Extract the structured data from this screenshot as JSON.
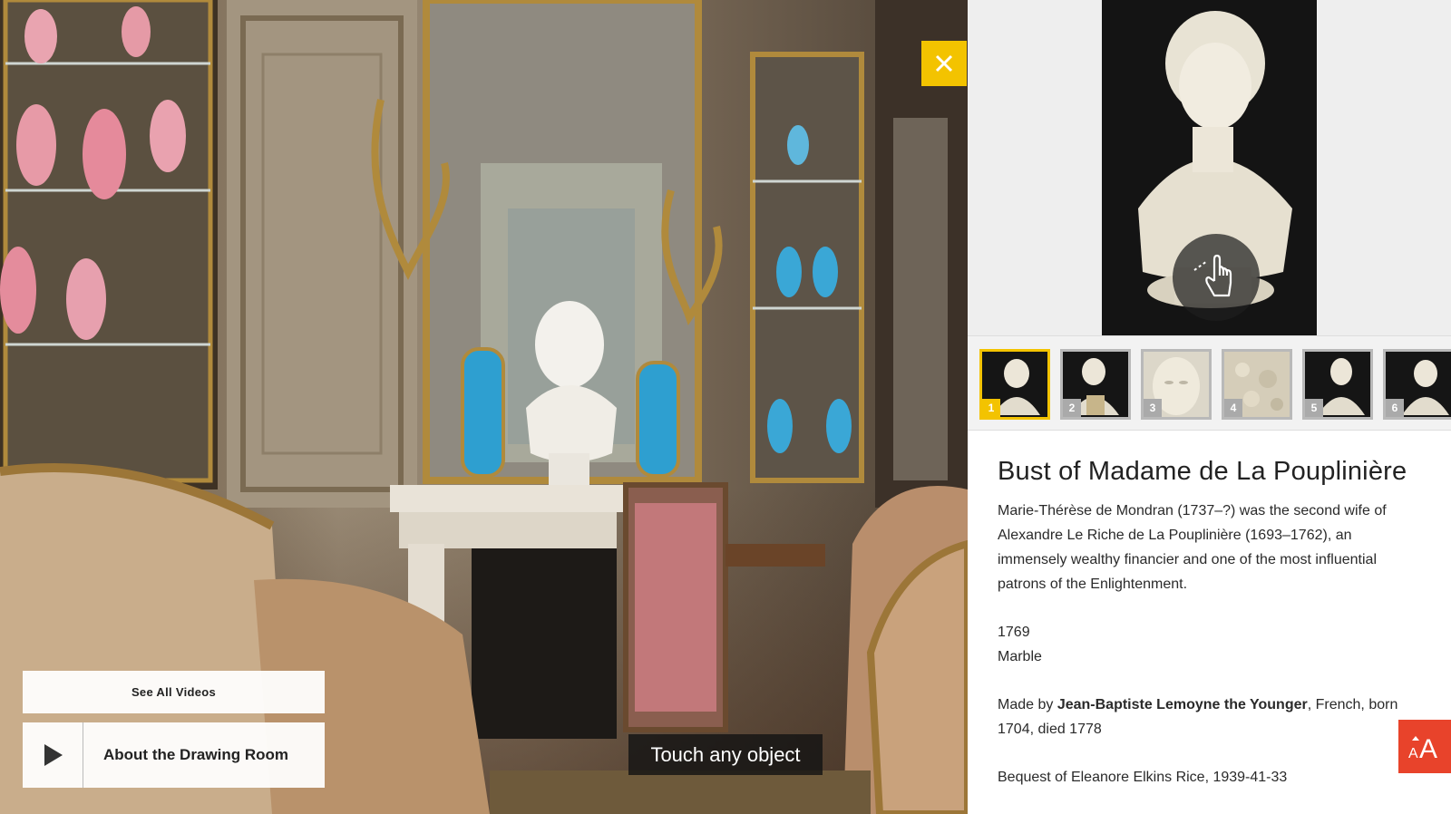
{
  "overlay": {
    "close_icon": "close-icon",
    "see_all_videos": "See All Videos",
    "video_title": "About the Drawing Room",
    "touch_hint": "Touch any object",
    "accent_color": "#f3c300"
  },
  "detail": {
    "title": "Bust of Madame de La Pouplinière",
    "description": "Marie-Thérèse de Mondran (1737–?) was the second wife of Alexandre Le Riche de La Pouplinière (1693–1762), an immensely wealthy financier and one of the most influential patrons of the Enlightenment.",
    "date": "1769",
    "medium": "Marble",
    "made_by_prefix": "Made by ",
    "artist": "Jean-Baptiste Lemoyne the Younger",
    "artist_suffix": ", French, born 1704, died 1778",
    "credit": "Bequest of Eleanore Elkins Rice, 1939-41-33",
    "gesture_icon": "swipe-hand-icon"
  },
  "thumbnails": [
    {
      "number": "1",
      "active": true
    },
    {
      "number": "2",
      "active": false
    },
    {
      "number": "3",
      "active": false
    },
    {
      "number": "4",
      "active": false
    },
    {
      "number": "5",
      "active": false
    },
    {
      "number": "6",
      "active": false
    }
  ],
  "text_size_button": {
    "label": "AA",
    "icon": "text-size-icon",
    "color": "#e8432b"
  }
}
